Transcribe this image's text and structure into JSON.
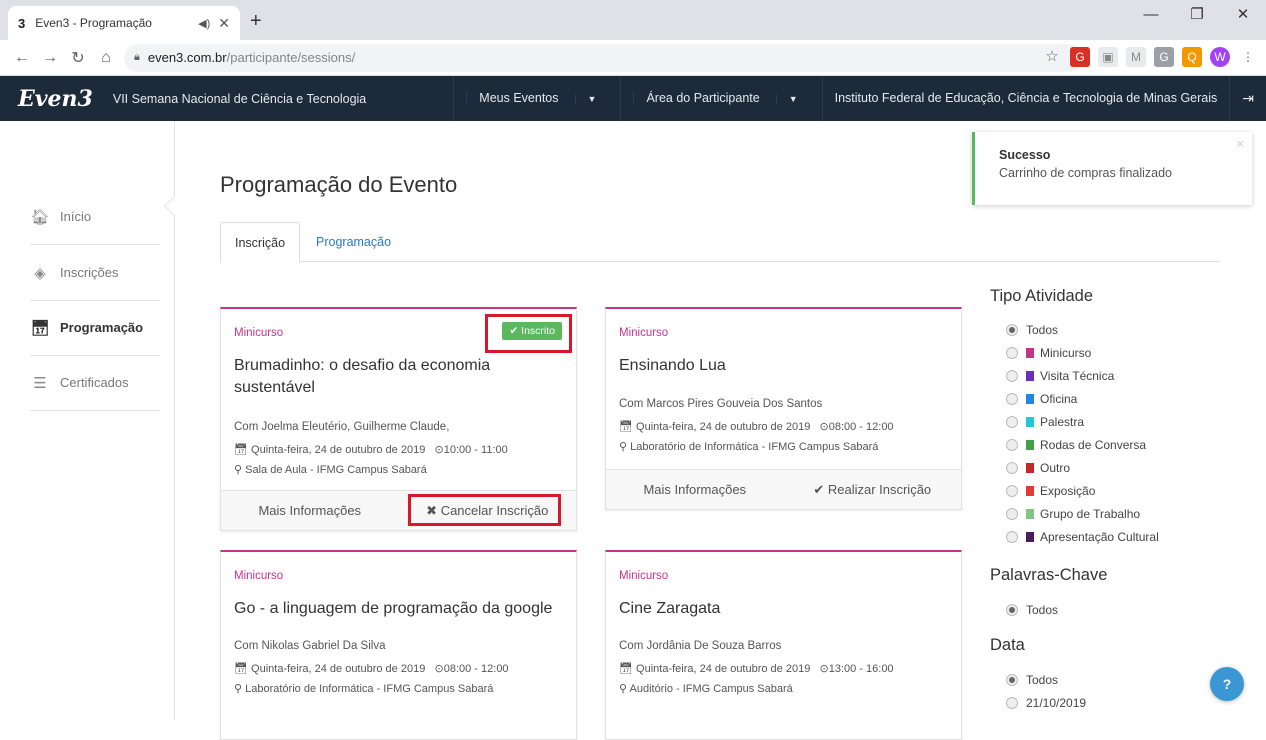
{
  "browser": {
    "tab_favicon": "3",
    "tab_title": "Even3 - Programação",
    "url_domain": "even3.com.br",
    "url_path": "/participante/sessions/"
  },
  "navbar": {
    "logo": "Even3",
    "event_name": "VII Semana Nacional de Ciência e Tecnologia",
    "my_events": "Meus Eventos",
    "participant_area": "Área do Participante",
    "institution": "Instituto Federal de Educação, Ciência e Tecnologia de Minas Gerais"
  },
  "sidebar": {
    "items": [
      {
        "label": "Início",
        "icon": "home-icon"
      },
      {
        "label": "Inscrições",
        "icon": "tag-icon"
      },
      {
        "label": "Programação",
        "icon": "calendar-icon"
      },
      {
        "label": "Certificados",
        "icon": "certificate-icon"
      }
    ]
  },
  "main": {
    "title": "Programação do Evento",
    "tabs": [
      "Inscrição",
      "Programação"
    ]
  },
  "cards": [
    {
      "category": "Minicurso",
      "badge": "Inscrito",
      "title": "Brumadinho: o desafio da economia sustentável",
      "speakers": "Com Joelma Eleutério, Guilherme Claude,",
      "date": "Quinta-feira, 24 de outubro de 2019",
      "time": "10:00 - 11:00",
      "location": "Sala de Aula - IFMG Campus Sabará",
      "more": "Mais Informações",
      "action": "Cancelar Inscrição"
    },
    {
      "category": "Minicurso",
      "title": "Ensinando Lua",
      "speakers": "Com Marcos Pires Gouveia Dos Santos",
      "date": "Quinta-feira, 24 de outubro de 2019",
      "time": "08:00 - 12:00",
      "location": "Laboratório de Informática - IFMG Campus Sabará",
      "more": "Mais Informações",
      "action": "Realizar Inscrição"
    },
    {
      "category": "Minicurso",
      "title": "Go - a linguagem de programação da google",
      "speakers": "Com Nikolas Gabriel Da Silva",
      "date": "Quinta-feira, 24 de outubro de 2019",
      "time": "08:00 - 12:00",
      "location": "Laboratório de Informática - IFMG Campus Sabará"
    },
    {
      "category": "Minicurso",
      "title": "Cine Zaragata",
      "speakers": "Com Jordânia De Souza Barros",
      "date": "Quinta-feira, 24 de outubro de 2019",
      "time": "13:00 - 16:00",
      "location": "Auditório - IFMG Campus Sabará"
    }
  ],
  "filters": {
    "activity_heading": "Tipo Atividade",
    "activity": [
      {
        "label": "Todos",
        "color": ""
      },
      {
        "label": "Minicurso",
        "color": "#c7338b"
      },
      {
        "label": "Visita Técnica",
        "color": "#6f2dbd"
      },
      {
        "label": "Oficina",
        "color": "#1e88e5"
      },
      {
        "label": "Palestra",
        "color": "#26c6da"
      },
      {
        "label": "Rodas de Conversa",
        "color": "#43a047"
      },
      {
        "label": "Outro",
        "color": "#c62828"
      },
      {
        "label": "Exposição",
        "color": "#e53935"
      },
      {
        "label": "Grupo de Trabalho",
        "color": "#81c784"
      },
      {
        "label": "Apresentação Cultural",
        "color": "#4a1c5c"
      }
    ],
    "keywords_heading": "Palavras-Chave",
    "keywords": [
      "Todos"
    ],
    "date_heading": "Data",
    "dates": [
      "Todos",
      "21/10/2019"
    ]
  },
  "toast": {
    "title": "Sucesso",
    "message": "Carrinho de compras finalizado"
  }
}
